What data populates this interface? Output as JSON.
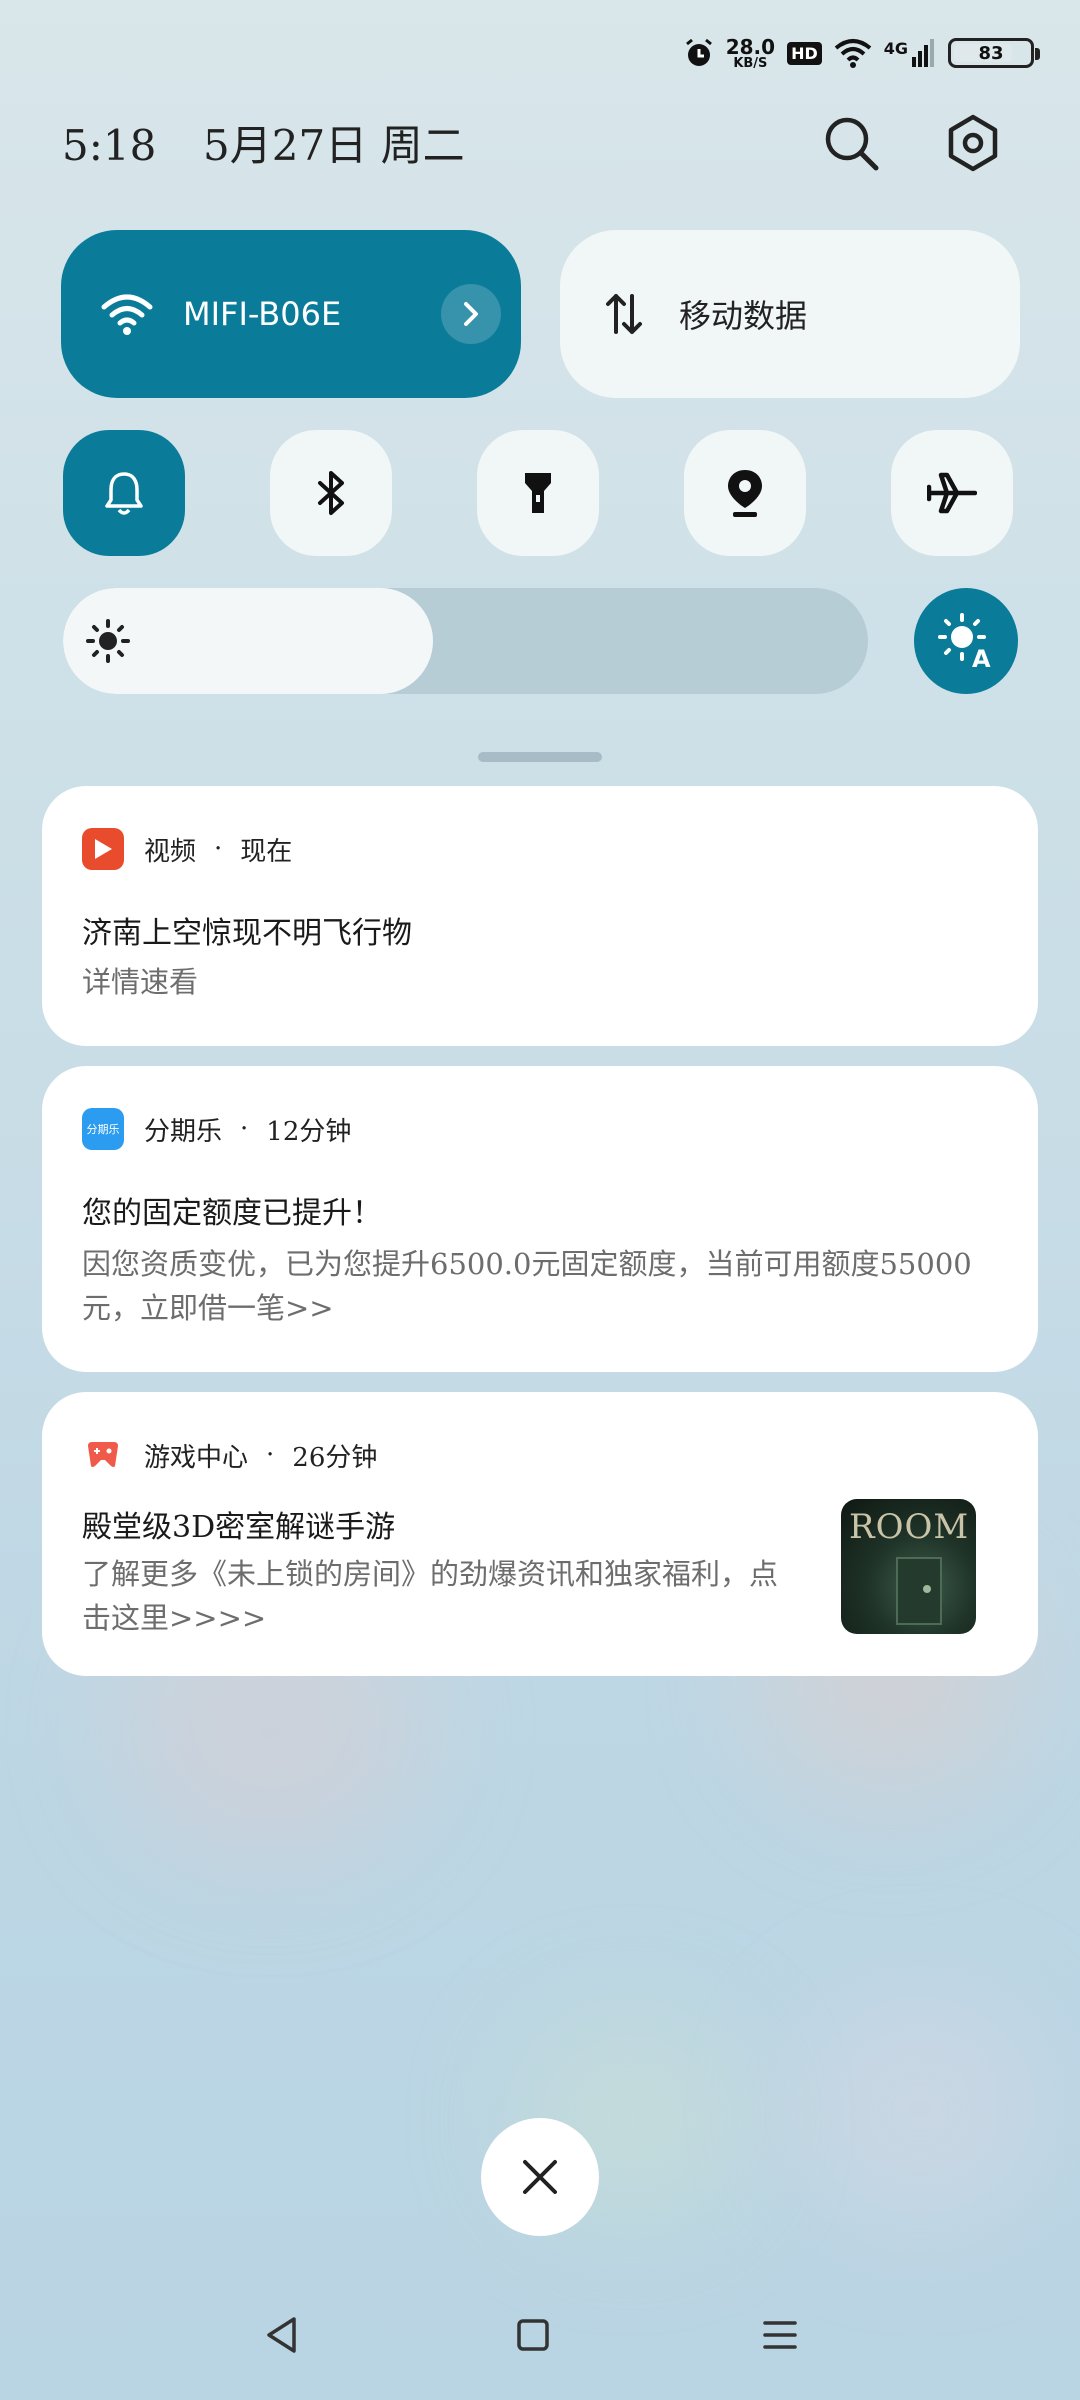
{
  "status_bar": {
    "speed_value": "28.0",
    "speed_unit": "KB/S",
    "hd_badge": "HD",
    "network_type": "4G",
    "battery_level": "83"
  },
  "header": {
    "time": "5:18",
    "date": "5月27日 周二"
  },
  "quick_settings": {
    "wifi_tile": {
      "label": "MIFI-B06E",
      "active": true
    },
    "data_tile": {
      "label": "移动数据",
      "active": false
    },
    "round_tiles": [
      {
        "icon": "bell-icon",
        "active": true
      },
      {
        "icon": "bluetooth-icon",
        "active": false
      },
      {
        "icon": "flashlight-icon",
        "active": false
      },
      {
        "icon": "location-icon",
        "active": false
      },
      {
        "icon": "airplane-icon",
        "active": false
      }
    ],
    "brightness_level": 0.46,
    "auto_brightness_badge": "A",
    "accent_color": "#0a7c99"
  },
  "notifications": [
    {
      "app": "视频",
      "time": "现在",
      "title": "济南上空惊现不明飞行物",
      "body": "详情速看",
      "icon_color": "#e94b2d"
    },
    {
      "app": "分期乐",
      "time": "12分钟",
      "title": "您的固定额度已提升！",
      "body": "因您资质变优，已为您提升6500.0元固定额度，当前可用额度55000元，立即借一笔>>",
      "icon_color": "#2c9cf0",
      "icon_text": "分期乐"
    },
    {
      "app": "游戏中心",
      "time": "26分钟",
      "title": "殿堂级3D密室解谜手游",
      "body": "了解更多《未上锁的房间》的劲爆资讯和独家福利，点击这里>>>>",
      "icon_color": "#ef5a4a",
      "thumbnail_text": "ROOM"
    }
  ]
}
